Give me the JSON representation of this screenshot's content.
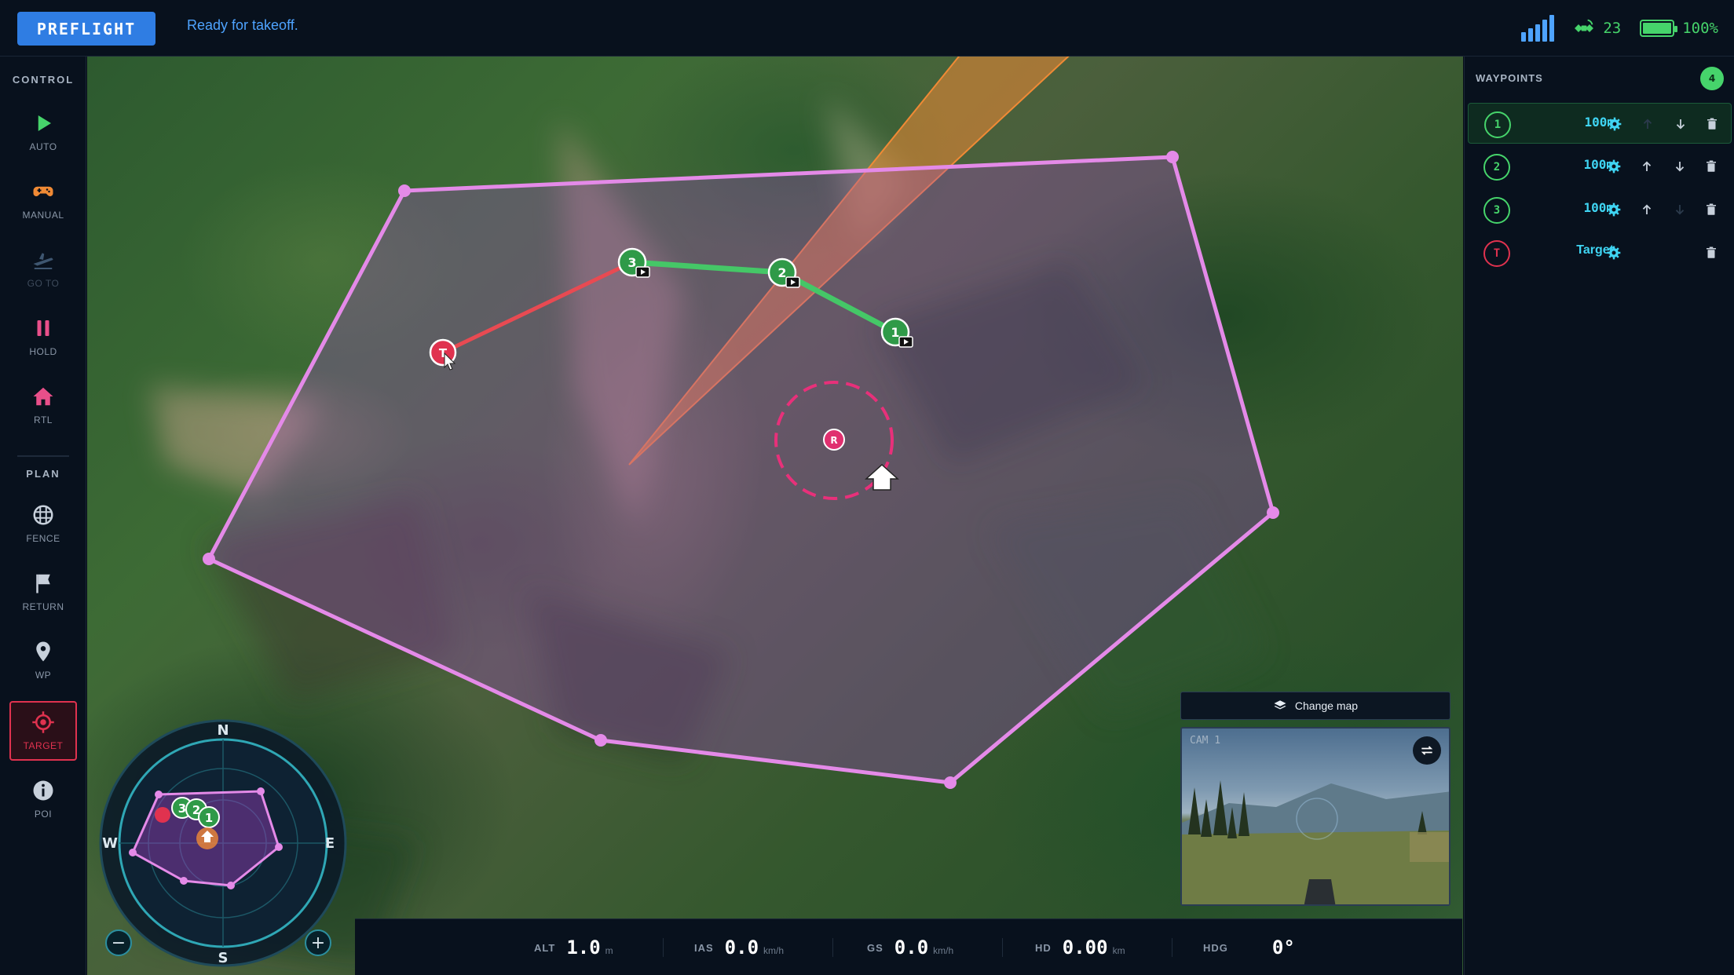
{
  "header": {
    "mode_label": "PREFLIGHT",
    "status": "Ready for takeoff.",
    "satellites": "23",
    "battery": "100%",
    "battery_level": 1.0
  },
  "sidebar": {
    "control_heading": "CONTROL",
    "plan_heading": "PLAN",
    "control_items": [
      {
        "label": "AUTO",
        "icon": "play-icon"
      },
      {
        "label": "MANUAL",
        "icon": "gamepad-icon"
      },
      {
        "label": "GO TO",
        "icon": "plane-icon",
        "disabled": true
      },
      {
        "label": "HOLD",
        "icon": "pause-icon"
      },
      {
        "label": "RTL",
        "icon": "home-icon"
      }
    ],
    "plan_items": [
      {
        "label": "FENCE",
        "icon": "grid-icon"
      },
      {
        "label": "RETURN",
        "icon": "flag-icon"
      },
      {
        "label": "WP",
        "icon": "pin-icon"
      },
      {
        "label": "TARGET",
        "icon": "target-icon",
        "active": true
      },
      {
        "label": "POI",
        "icon": "info-icon"
      }
    ]
  },
  "map": {
    "markers": {
      "wp1": "1",
      "wp2": "2",
      "wp3": "3",
      "target": "T",
      "rally": "R"
    },
    "compass": {
      "n": "N",
      "s": "S",
      "e": "E",
      "w": "W"
    },
    "zoom_out": "−",
    "zoom_in": "+",
    "change_map_label": "Change map",
    "camera_label": "CAM 1"
  },
  "telemetry": [
    {
      "key": "ALT",
      "value": "1.0",
      "unit": "m"
    },
    {
      "key": "IAS",
      "value": "0.0",
      "unit": "km/h"
    },
    {
      "key": "GS",
      "value": "0.0",
      "unit": "km/h"
    },
    {
      "key": "HD",
      "value": "0.00",
      "unit": "km"
    },
    {
      "key": "HDG",
      "value": "0°",
      "unit": ""
    }
  ],
  "waypoints": {
    "heading": "WAYPOINTS",
    "count": "4",
    "rows": [
      {
        "badge": "1",
        "value": "100m"
      },
      {
        "badge": "2",
        "value": "100m"
      },
      {
        "badge": "3",
        "value": "100m"
      },
      {
        "badge": "T",
        "value": "Target"
      }
    ]
  },
  "colors": {
    "accent": "#2f7de3",
    "waypoint_green": "#46d46b",
    "target_red": "#e0324f",
    "fence_pink": "#e48ae8",
    "value_cyan": "#3fd4f2",
    "heading_orange": "#f08a35"
  }
}
